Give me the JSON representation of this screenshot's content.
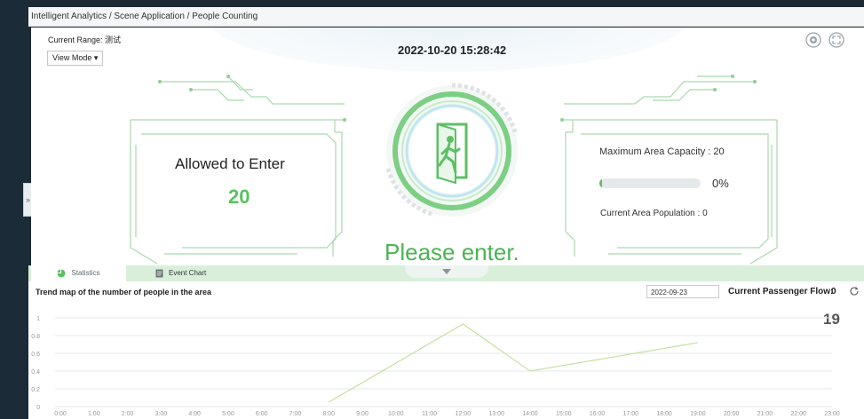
{
  "breadcrumb": "Intelligent Analytics / Scene Application / People Counting",
  "header": {
    "current_range_label": "Current Range: 测试",
    "view_mode_label": "View Mode",
    "datetime": "2022-10-20 15:28:42",
    "settings_icon": "gear-icon",
    "fullscreen_icon": "expand-icon"
  },
  "status": {
    "allowed_label": "Allowed to Enter",
    "allowed_value": "20",
    "message": "Please enter.",
    "door_icon": "person-entering-door-icon",
    "accent_color": "#5cc063"
  },
  "capacity": {
    "max_label": "Maximum Area Capacity : 20",
    "progress_percent": 0,
    "percent_text": "0%",
    "population_label": "Current Area Population : 0"
  },
  "tabs": [
    {
      "label": "Statistics",
      "icon": "pie-chart-icon",
      "active": true
    },
    {
      "label": "Event Chart",
      "icon": "document-icon",
      "active": false
    }
  ],
  "trend": {
    "title": "Trend map of the number of people in the area",
    "date": "2022-09-23",
    "flow_label": "Current Passenger Flow:",
    "flow_value": "0",
    "big_count": "19"
  },
  "chart_data": {
    "type": "line",
    "title": "Trend map of the number of people in the area",
    "xlabel": "",
    "ylabel": "",
    "categories": [
      "0:00",
      "1:00",
      "2:00",
      "3:00",
      "4:00",
      "5:00",
      "6:00",
      "7:00",
      "8:00",
      "9:00",
      "10:00",
      "11:00",
      "12:00",
      "13:00",
      "14:00",
      "15:00",
      "16:00",
      "17:00",
      "18:00",
      "19:00",
      "20:00",
      "21:00",
      "22:00",
      "23:00"
    ],
    "y_ticks": [
      "0",
      "0.2",
      "0.4",
      "0.6",
      "0.8",
      "1"
    ],
    "ylim": [
      0,
      1
    ],
    "grid": true,
    "series": [
      {
        "x": [
          "8:00",
          "12:00",
          "14:00",
          "19:00"
        ],
        "values": [
          0.05,
          0.93,
          0.4,
          0.72
        ]
      }
    ],
    "line_color": "#c8e2a6"
  }
}
